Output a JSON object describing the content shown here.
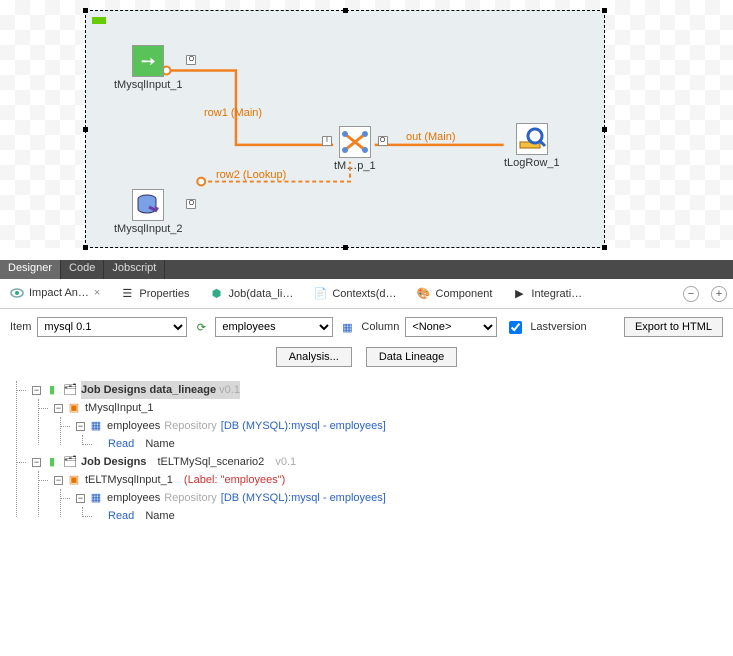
{
  "canvas": {
    "nodes": {
      "n1": {
        "label": "tMysqlInput_1"
      },
      "n2": {
        "label": "tMysqlInput_2"
      },
      "n3": {
        "label": "tM…p_1"
      },
      "n4": {
        "label": "tLogRow_1"
      }
    },
    "flows": {
      "f1": "row1  (Main)",
      "f2": "row2 (Lookup)",
      "f3": "out  (Main)"
    }
  },
  "tabs": {
    "designer": "Designer",
    "code": "Code",
    "jobscript": "Jobscript"
  },
  "views": {
    "impact": "Impact An…",
    "properties": "Properties",
    "job": "Job(data_li…",
    "contexts": "Contexts(d…",
    "component": "Component",
    "integration": "Integrati…"
  },
  "filter": {
    "item_label": "Item",
    "item_value": "mysql 0.1",
    "table_value": "employees",
    "column_label": "Column",
    "column_value": "<None>",
    "lastversion": "Lastversion",
    "export": "Export to HTML",
    "analysis": "Analysis...",
    "lineage": "Data Lineage"
  },
  "tree": {
    "jd1": {
      "title": "Job Designs",
      "name": "data_lineage",
      "ver": "v0.1"
    },
    "jd1_comp": "tMysqlInput_1",
    "jd1_table": {
      "name": "employees",
      "repo": "Repository",
      "src": "[DB (MYSQL):mysql - employees]"
    },
    "jd1_rw": {
      "op": "Read",
      "col": "Name"
    },
    "jd2": {
      "title": "Job Designs",
      "name": "tELTMySql_scenario2",
      "ver": "v0.1"
    },
    "jd2_comp": {
      "name": "tELTMysqlInput_1",
      "label": "(Label: \"employees\")"
    },
    "jd2_table": {
      "name": "employees",
      "repo": "Repository",
      "src": "[DB (MYSQL):mysql - employees]"
    },
    "jd2_rw": {
      "op": "Read",
      "col": "Name"
    }
  }
}
